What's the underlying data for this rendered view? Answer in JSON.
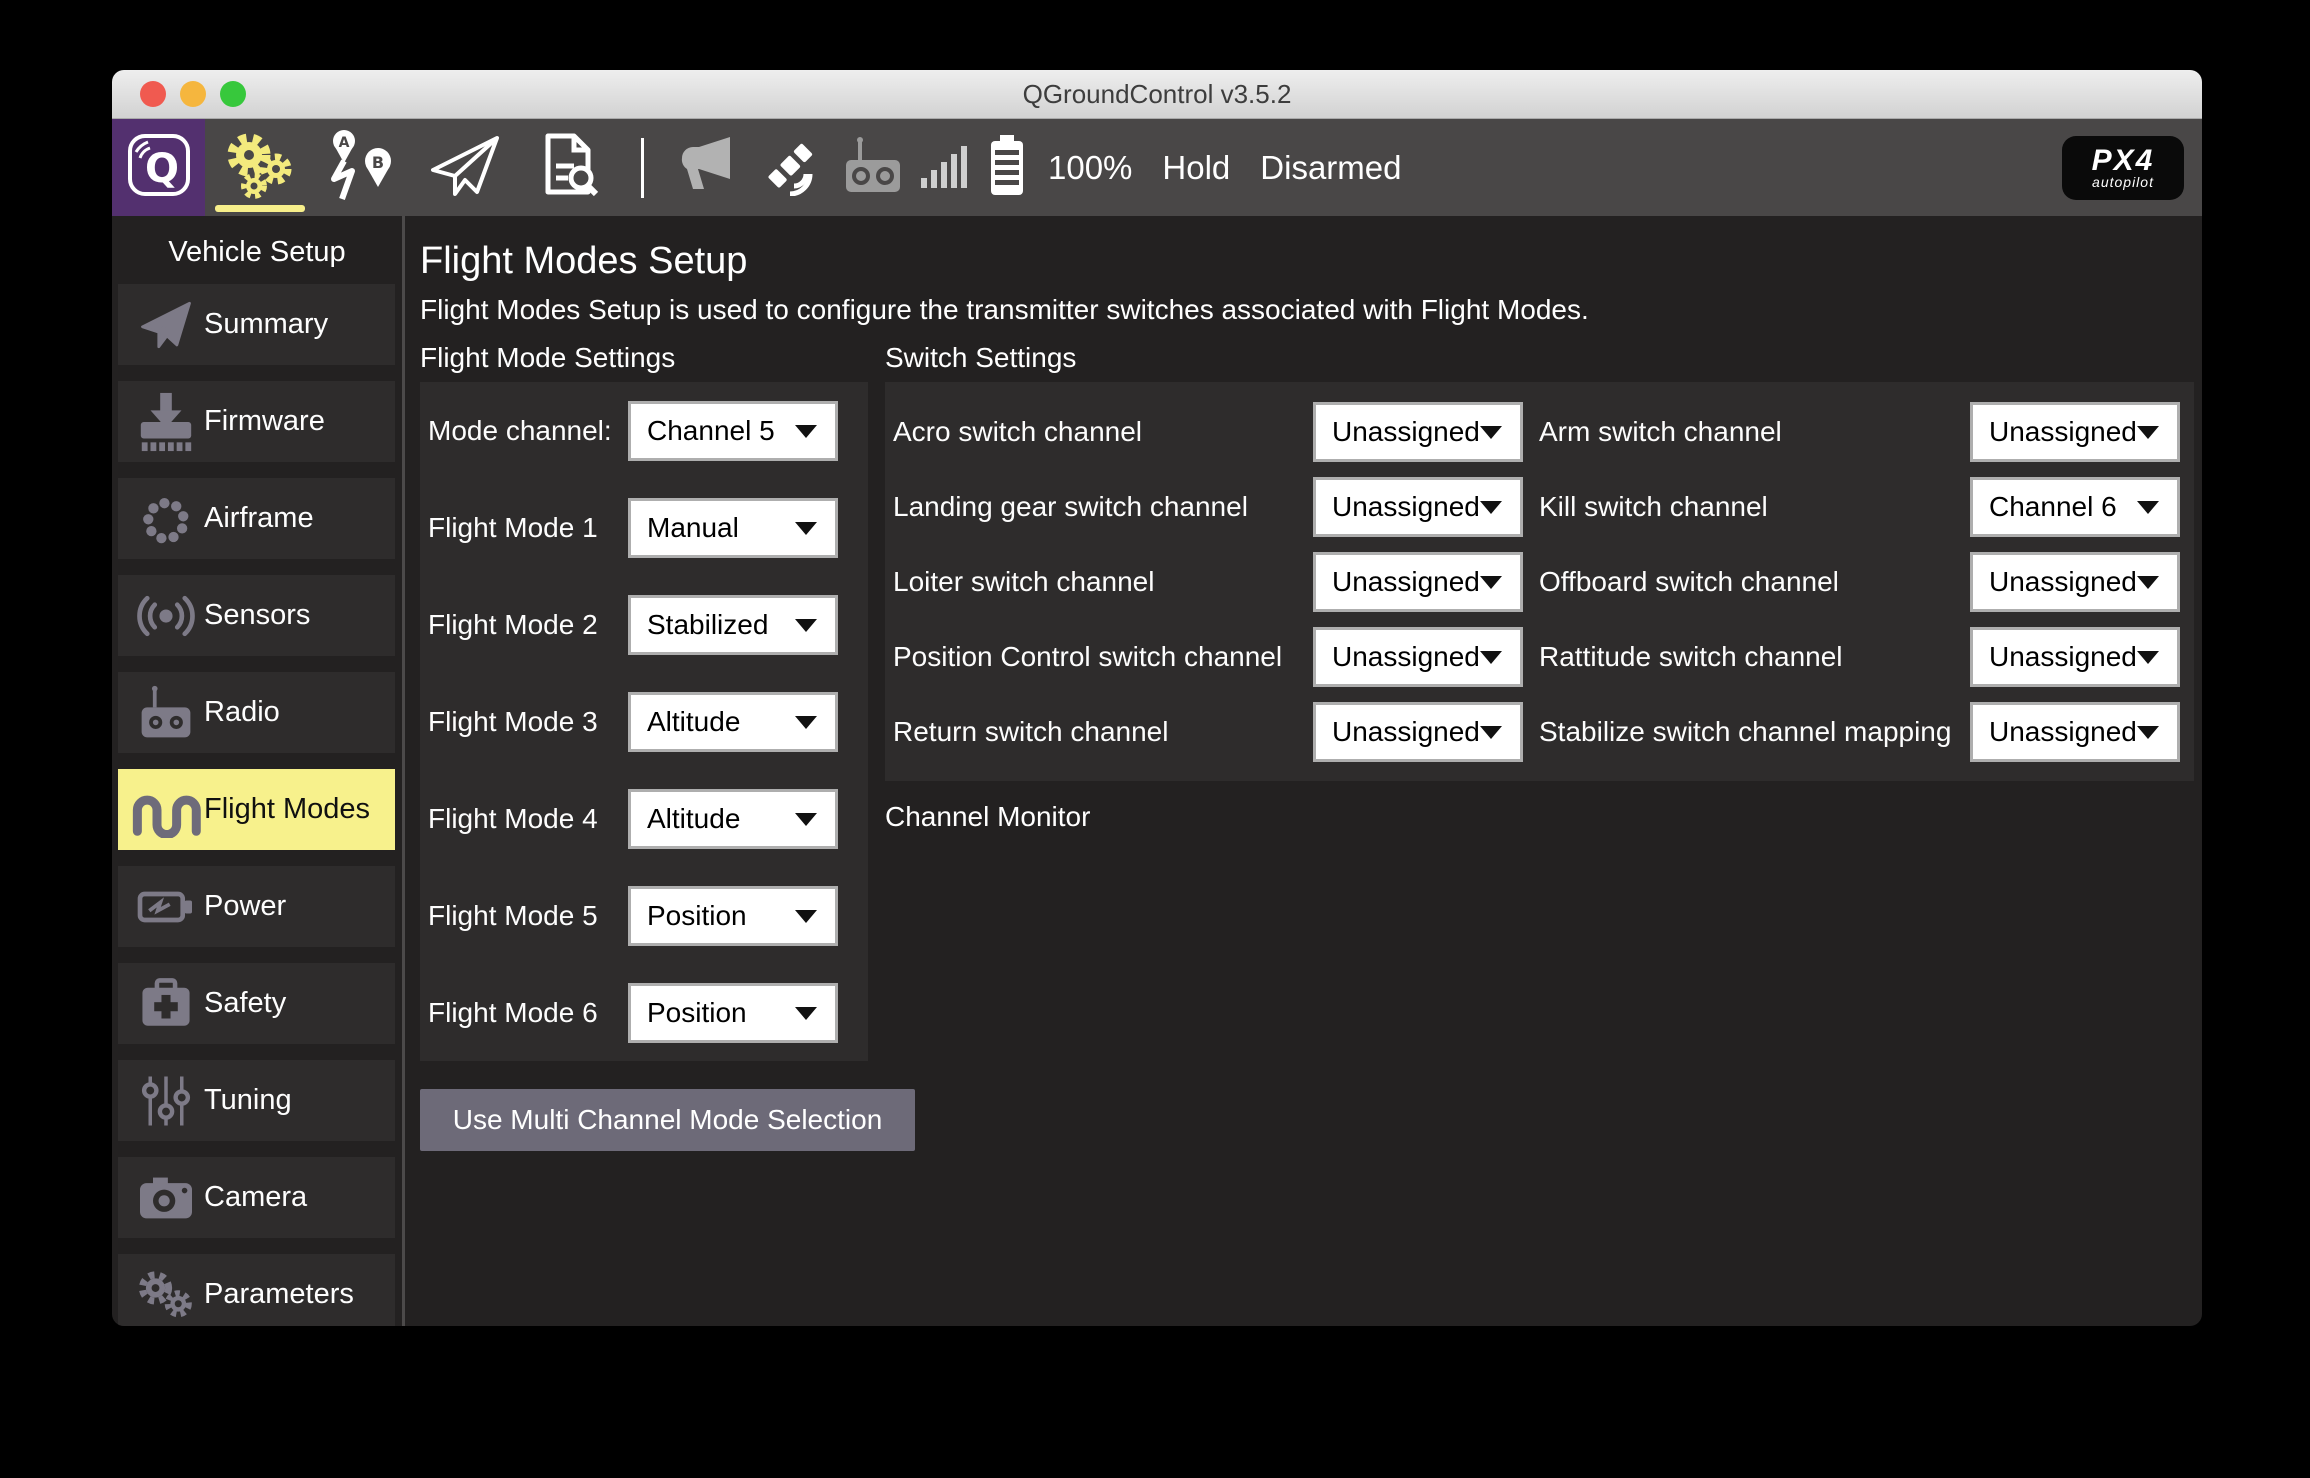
{
  "window": {
    "title": "QGroundControl v3.5.2"
  },
  "toolbar": {
    "battery_pct": "100%",
    "flight_mode": "Hold",
    "armed_state": "Disarmed",
    "px4_logo_line1": "PX4",
    "px4_logo_line2": "autopilot",
    "buttons": [
      {
        "name": "qgc-home",
        "icon": "qgc-logo"
      },
      {
        "name": "vehicle-setup",
        "icon": "gears",
        "active": true
      },
      {
        "name": "plan",
        "icon": "waypoints"
      },
      {
        "name": "fly",
        "icon": "paper-plane"
      },
      {
        "name": "analyze",
        "icon": "log-file"
      }
    ],
    "status_icons": [
      "megaphone",
      "satellite",
      "rc-transmitter",
      "signal-bars",
      "battery"
    ]
  },
  "sidebar": {
    "header": "Vehicle Setup",
    "items": [
      {
        "label": "Summary",
        "icon": "plane",
        "active": false
      },
      {
        "label": "Firmware",
        "icon": "firmware",
        "active": false
      },
      {
        "label": "Airframe",
        "icon": "airframe",
        "active": false
      },
      {
        "label": "Sensors",
        "icon": "sensors",
        "active": false
      },
      {
        "label": "Radio",
        "icon": "radio",
        "active": false
      },
      {
        "label": "Flight Modes",
        "icon": "flightmodes",
        "active": true
      },
      {
        "label": "Power",
        "icon": "power",
        "active": false
      },
      {
        "label": "Safety",
        "icon": "safety",
        "active": false
      },
      {
        "label": "Tuning",
        "icon": "tuning",
        "active": false
      },
      {
        "label": "Camera",
        "icon": "camera",
        "active": false
      },
      {
        "label": "Parameters",
        "icon": "parameters",
        "active": false
      }
    ]
  },
  "main": {
    "title": "Flight Modes Setup",
    "description": "Flight Modes Setup is used to configure the transmitter switches associated with Flight Modes.",
    "flight_mode_settings": {
      "header": "Flight Mode Settings",
      "rows": [
        {
          "label": "Mode channel:",
          "value": "Channel 5"
        },
        {
          "label": "Flight Mode 1",
          "value": "Manual"
        },
        {
          "label": "Flight Mode 2",
          "value": "Stabilized"
        },
        {
          "label": "Flight Mode 3",
          "value": "Altitude"
        },
        {
          "label": "Flight Mode 4",
          "value": "Altitude"
        },
        {
          "label": "Flight Mode 5",
          "value": "Position"
        },
        {
          "label": "Flight Mode 6",
          "value": "Position"
        }
      ]
    },
    "switch_settings": {
      "header": "Switch Settings",
      "left_rows": [
        {
          "label": "Acro switch channel",
          "value": "Unassigned"
        },
        {
          "label": "Landing gear switch channel",
          "value": "Unassigned"
        },
        {
          "label": "Loiter switch channel",
          "value": "Unassigned"
        },
        {
          "label": "Position Control switch channel",
          "value": "Unassigned"
        },
        {
          "label": "Return switch channel",
          "value": "Unassigned"
        }
      ],
      "right_rows": [
        {
          "label": "Arm switch channel",
          "value": "Unassigned"
        },
        {
          "label": "Kill switch channel",
          "value": "Channel 6"
        },
        {
          "label": "Offboard switch channel",
          "value": "Unassigned"
        },
        {
          "label": "Rattitude switch channel",
          "value": "Unassigned"
        },
        {
          "label": "Stabilize switch channel mapping",
          "value": "Unassigned"
        }
      ]
    },
    "multi_channel_button": "Use Multi Channel Mode Selection",
    "channel_monitor_header": "Channel Monitor"
  },
  "colors": {
    "accent_purple": "#53306f",
    "accent_yellow": "#f7f18c",
    "toolbar_bg": "#494747",
    "content_bg": "#232121",
    "panel_bg": "#2e2c2c",
    "button_bg": "#6d6a78",
    "dropdown_border": "#aeaeae"
  }
}
